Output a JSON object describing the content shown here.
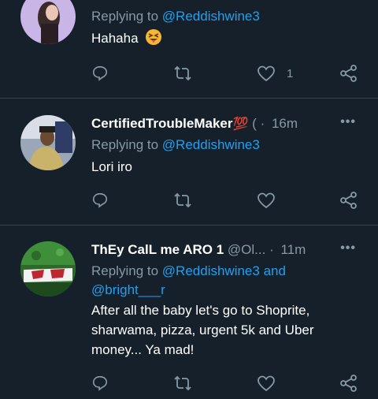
{
  "tweets": [
    {
      "replying_prefix": "Replying to",
      "replying_to": "@Reddishwine3",
      "text": "Hahaha",
      "emoji": "squinting-face-with-tongue",
      "like_count": "1"
    },
    {
      "username": "CertifiedTroubleMaker",
      "username_emoji": "💯",
      "handle": "(",
      "sep": "·",
      "time": "16m",
      "replying_prefix": "Replying to",
      "replying_to": "@Reddishwine3",
      "text": "Lori iro"
    },
    {
      "username": "ThEy CalL me ARO 1",
      "handle": "@Ol...",
      "sep": "·",
      "time": "11m",
      "replying_prefix": "Replying to",
      "replying_to": "@Reddishwine3",
      "and_text": "and",
      "replying_to_2": "@bright___r",
      "text": "After all the baby let's go to Shoprite, sharwama, pizza, urgent 5k and Uber money... Ya mad!"
    }
  ],
  "icons": {
    "reply": "reply-icon",
    "retweet": "retweet-icon",
    "like": "heart-icon",
    "share": "share-icon",
    "more": "more-icon"
  },
  "colors": {
    "background": "#15202b",
    "divider": "#38444d",
    "secondary_text": "#8899a6",
    "link": "#1da1f2"
  }
}
